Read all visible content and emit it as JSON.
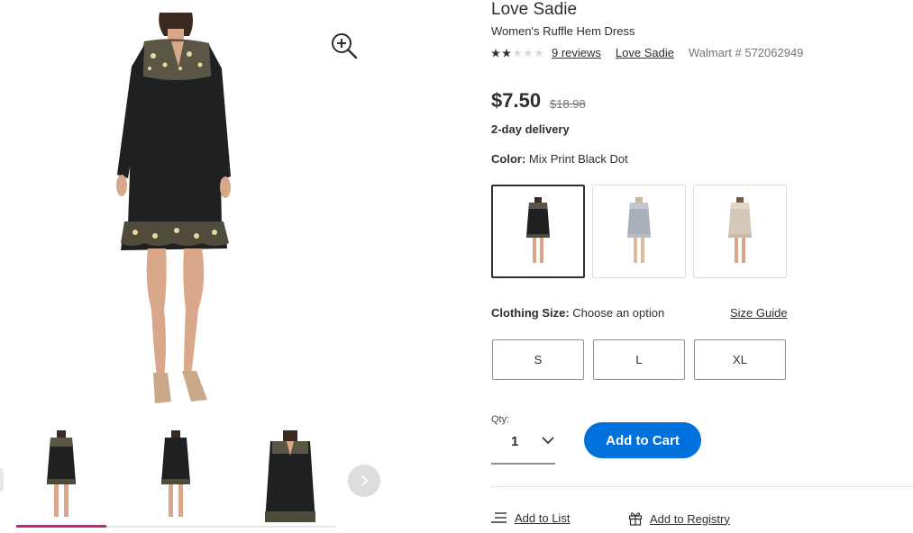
{
  "product": {
    "brand": "Love Sadie",
    "name": "Women's Ruffle Hem Dress",
    "rating_stars": 2.5,
    "reviews_label": "9 reviews",
    "brand_link": "Love Sadie",
    "walmart_number": "Walmart # 572062949"
  },
  "pricing": {
    "price": "$7.50",
    "was_price": "$18.98",
    "delivery": "2-day delivery"
  },
  "color": {
    "label": "Color:",
    "value": "Mix Print Black Dot",
    "swatches": [
      "black-dot",
      "grey",
      "beige"
    ]
  },
  "size": {
    "label": "Clothing Size:",
    "value": "Choose an option",
    "guide_label": "Size Guide",
    "options": [
      "S",
      "L",
      "XL"
    ]
  },
  "quantity": {
    "label": "Qty:",
    "value": "1"
  },
  "actions": {
    "add_to_cart": "Add to Cart",
    "add_to_list": "Add to List",
    "add_to_registry": "Add to Registry"
  },
  "colors": {
    "accent_blue": "#0071dc",
    "thumb_active": "#c8257a",
    "star": "#2e2f32"
  }
}
